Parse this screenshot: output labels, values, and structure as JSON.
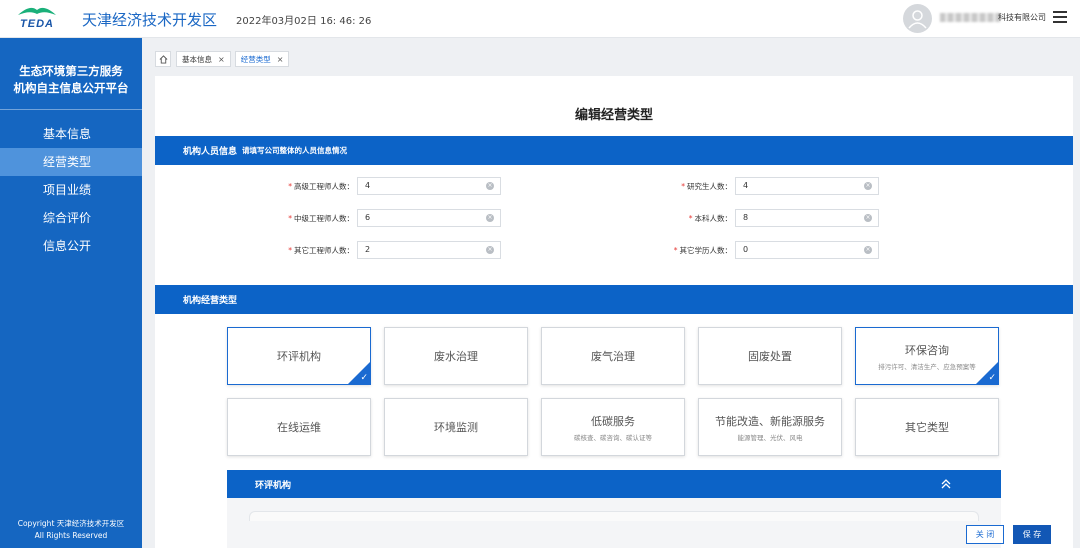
{
  "header": {
    "logo_text": "TEDA",
    "app_title": "天津经济技术开发区",
    "datetime": "2022年03月02日 16: 46: 26",
    "company_suffix": "科技有限公司"
  },
  "sidebar": {
    "platform_title_line1": "生态环境第三方服务",
    "platform_title_line2": "机构自主信息公开平台",
    "items": [
      {
        "label": "基本信息"
      },
      {
        "label": "经营类型"
      },
      {
        "label": "项目业绩"
      },
      {
        "label": "综合评价"
      },
      {
        "label": "信息公开"
      }
    ],
    "active_index": 1,
    "copyright_line1": "Copyright 天津经济技术开发区",
    "copyright_line2": "All Rights Reserved"
  },
  "breadcrumb": {
    "tabs": [
      {
        "label": "基本信息",
        "close": "×"
      },
      {
        "label": "经营类型",
        "close": "×"
      }
    ]
  },
  "page": {
    "title": "编辑经营类型"
  },
  "personnel": {
    "section_title": "机构人员信息",
    "section_hint": "请填写公司整体的人员信息情况",
    "required_mark": "*",
    "clear_symbol": "×",
    "fields": [
      {
        "label": "高级工程师人数：",
        "value": "4"
      },
      {
        "label": "研究生人数：",
        "value": "4"
      },
      {
        "label": "中级工程师人数：",
        "value": "6"
      },
      {
        "label": "本科人数：",
        "value": "8"
      },
      {
        "label": "其它工程师人数：",
        "value": "2"
      },
      {
        "label": "其它学历人数：",
        "value": "0"
      }
    ]
  },
  "business": {
    "section_title": "机构经营类型",
    "check_symbol": "✓",
    "types": [
      {
        "name": "环评机构",
        "sub": "",
        "selected": true
      },
      {
        "name": "废水治理",
        "sub": "",
        "selected": false
      },
      {
        "name": "废气治理",
        "sub": "",
        "selected": false
      },
      {
        "name": "固废处置",
        "sub": "",
        "selected": false
      },
      {
        "name": "环保咨询",
        "sub": "排污许可、清洁生产、应急预案等",
        "selected": true
      },
      {
        "name": "在线运维",
        "sub": "",
        "selected": false
      },
      {
        "name": "环境监测",
        "sub": "",
        "selected": false
      },
      {
        "name": "低碳服务",
        "sub": "碳核查、碳咨询、碳认证等",
        "selected": false
      },
      {
        "name": "节能改造、新能源服务",
        "sub": "能源管理、光伏、风电",
        "selected": false
      },
      {
        "name": "其它类型",
        "sub": "",
        "selected": false
      }
    ],
    "detail_title": "环评机构"
  },
  "actions": {
    "close_label": "关 闭",
    "save_label": "保 存"
  },
  "colors": {
    "primary": "#0c63c7",
    "sidebar": "#1566c1",
    "sidebar_active": "#4f93dc",
    "required": "#e53935"
  }
}
